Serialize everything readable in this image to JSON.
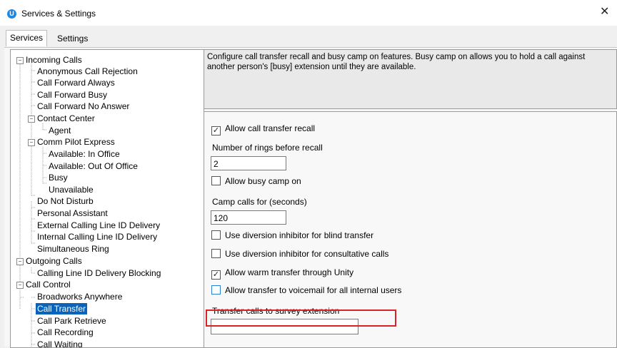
{
  "window": {
    "title": "Services & Settings",
    "app_icon_letter": "U",
    "close_glyph": "✕"
  },
  "tabs": [
    {
      "label": "Services"
    },
    {
      "label": "Settings"
    }
  ],
  "tree": {
    "items": [
      {
        "label": "Incoming Calls",
        "expander": "−"
      },
      {
        "label": "Anonymous Call Rejection"
      },
      {
        "label": "Call Forward Always"
      },
      {
        "label": "Call Forward Busy"
      },
      {
        "label": "Call Forward No Answer"
      },
      {
        "label": "Contact Center",
        "expander": "−"
      },
      {
        "label": "Agent"
      },
      {
        "label": "Comm Pilot Express",
        "expander": "−"
      },
      {
        "label": "Available: In Office"
      },
      {
        "label": "Available: Out Of Office"
      },
      {
        "label": "Busy"
      },
      {
        "label": "Unavailable"
      },
      {
        "label": "Do Not Disturb"
      },
      {
        "label": "Personal Assistant"
      },
      {
        "label": "External Calling Line ID Delivery"
      },
      {
        "label": "Internal Calling Line ID Delivery"
      },
      {
        "label": "Simultaneous Ring"
      },
      {
        "label": "Outgoing Calls",
        "expander": "−"
      },
      {
        "label": "Calling Line ID Delivery Blocking"
      },
      {
        "label": "Call Control",
        "expander": "−"
      },
      {
        "label": "Broadworks Anywhere"
      },
      {
        "label": "Call Transfer",
        "selected": true
      },
      {
        "label": "Call Park Retrieve"
      },
      {
        "label": "Call Recording"
      },
      {
        "label": "Call Waiting"
      }
    ]
  },
  "description": "Configure call transfer recall and busy camp on features.  Busy camp on allows you to hold a call against another person's [busy] extension until they are available.",
  "settings": {
    "allow_recall": {
      "label": "Allow call transfer recall",
      "checked": true,
      "mark": "✓"
    },
    "rings_label": "Number of rings before recall",
    "rings_value": "2",
    "allow_busy_camp": {
      "label": "Allow busy camp on",
      "checked": false
    },
    "camp_label": "Camp calls for (seconds)",
    "camp_value": "120",
    "diversion_blind": {
      "label": "Use diversion inhibitor for blind transfer",
      "checked": false
    },
    "diversion_consult": {
      "label": "Use diversion inhibitor for consultative calls",
      "checked": false
    },
    "warm_transfer": {
      "label": "Allow warm transfer through Unity",
      "checked": true,
      "mark": "✓"
    },
    "voicemail_transfer": {
      "label": "Allow transfer to voicemail for all internal users",
      "checked": false
    },
    "survey_label": "Transfer calls to survey extension",
    "survey_value": ""
  },
  "colors": {
    "selection": "#0a63b8",
    "highlight_box": "#d9232b",
    "app_icon": "#1e88e5"
  }
}
